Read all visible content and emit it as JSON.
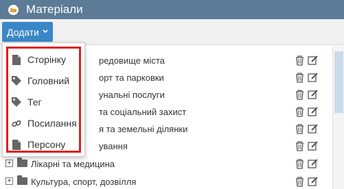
{
  "header": {
    "title": "Матеріали"
  },
  "toolbar": {
    "add_label": "Додати"
  },
  "dropdown": {
    "items": [
      {
        "label": "Сторінку",
        "icon": "file-icon"
      },
      {
        "label": "Головний",
        "icon": "tag-icon"
      },
      {
        "label": "Тег",
        "icon": "tag-icon"
      },
      {
        "label": "Посилання",
        "icon": "link-icon"
      },
      {
        "label": "Персону",
        "icon": "file-icon"
      }
    ]
  },
  "list": {
    "rows": [
      {
        "label": "редовище міста"
      },
      {
        "label": "орт та парковки"
      },
      {
        "label": "унальні послуги"
      },
      {
        "label": "та соціальний захист"
      },
      {
        "label": "я та земельні ділянки"
      },
      {
        "label": "ування"
      },
      {
        "label": "Лікарні та медицина"
      },
      {
        "label": "Культура, спорт, дозвілля"
      }
    ]
  },
  "colors": {
    "header_bg": "#5c7b96",
    "toolbar_bg": "#f0f0f0",
    "button_bg": "#3a87c8",
    "highlight_border": "#e01f1f"
  }
}
